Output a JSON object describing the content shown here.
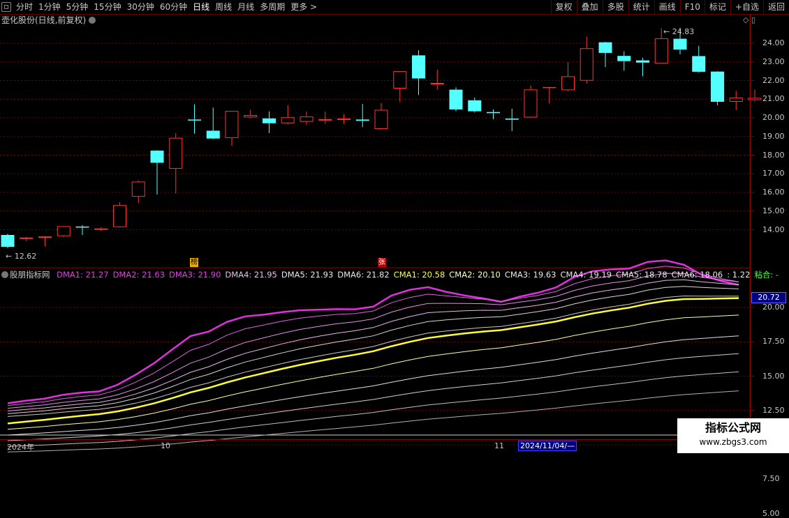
{
  "toolbar": {
    "tabs": [
      "分时",
      "1分钟",
      "5分钟",
      "15分钟",
      "30分钟",
      "60分钟",
      "日线",
      "周线",
      "月线",
      "多周期",
      "更多 >"
    ],
    "active_tab": "日线",
    "right_buttons": [
      "复权",
      "叠加",
      "多股",
      "统计",
      "画线",
      "F10",
      "标记",
      "+自选",
      "返回"
    ]
  },
  "stock_title": "壶化股份(日线,前复权)",
  "price_axis": [
    "24.00",
    "23.00",
    "22.00",
    "21.00",
    "20.00",
    "19.00",
    "18.00",
    "17.00",
    "16.00",
    "15.00",
    "14.00"
  ],
  "indicator_axis": [
    "20.00",
    "17.50",
    "15.00",
    "12.50",
    "10.00",
    "7.50",
    "5.00"
  ],
  "current_value": "20.72",
  "annotations": {
    "high": "24.83",
    "low": "12.62",
    "tag1": "榜",
    "tag2": "张"
  },
  "indicator": {
    "name": "股朋指标网",
    "items": [
      {
        "label": "DMA1: 21.27",
        "color": "#e040e0"
      },
      {
        "label": "DMA2: 21.63",
        "color": "#e040e0"
      },
      {
        "label": "DMA3: 21.90",
        "color": "#e040e0"
      },
      {
        "label": "DMA4: 21.95",
        "color": "#e8c0e8"
      },
      {
        "label": "DMA5: 21.93",
        "color": "#e8e8e8"
      },
      {
        "label": "DMA6: 21.82",
        "color": "#e8e8e8"
      },
      {
        "label": "CMA1: 20.58",
        "color": "#ffff40"
      },
      {
        "label": "CMA2: 20.10",
        "color": "#ffffc0"
      },
      {
        "label": "CMA3: 19.63",
        "color": "#e8e8e8"
      },
      {
        "label": "CMA4: 19.19",
        "color": "#e8e8e8"
      },
      {
        "label": "CMA5: 18.78",
        "color": "#e8e8e8"
      },
      {
        "label": "CMA6: 18.06",
        "color": "#e8e8e8"
      },
      {
        "label": ": 1.22",
        "color": "#e8e8e8"
      },
      {
        "label": "粘合: -",
        "color": "#40ff40"
      }
    ]
  },
  "date_axis": {
    "start": "2024年",
    "m1": "10",
    "m2": "11",
    "cursor": "2024/11/04/—"
  },
  "watermark": {
    "line1": "指标公式网",
    "line2": "www.zbgs3.com"
  },
  "chart_data": {
    "type": "candlestick",
    "candles": [
      {
        "o": 13.72,
        "h": 13.78,
        "l": 13.02,
        "c": 13.08
      },
      {
        "o": 13.52,
        "h": 13.62,
        "l": 13.38,
        "c": 13.58
      },
      {
        "o": 13.57,
        "h": 13.66,
        "l": 13.11,
        "c": 13.64
      },
      {
        "o": 13.66,
        "h": 14.2,
        "l": 13.6,
        "c": 14.19
      },
      {
        "o": 14.17,
        "h": 14.25,
        "l": 13.72,
        "c": 14.13
      },
      {
        "o": 13.99,
        "h": 14.14,
        "l": 13.94,
        "c": 14.07
      },
      {
        "o": 14.14,
        "h": 15.48,
        "l": 14.11,
        "c": 15.32
      },
      {
        "o": 15.77,
        "h": 16.64,
        "l": 15.43,
        "c": 16.58
      },
      {
        "o": 18.24,
        "h": 18.27,
        "l": 15.89,
        "c": 17.59
      },
      {
        "o": 17.27,
        "h": 19.18,
        "l": 15.94,
        "c": 18.93
      },
      {
        "o": 19.91,
        "h": 20.72,
        "l": 19.15,
        "c": 19.89
      },
      {
        "o": 19.31,
        "h": 20.55,
        "l": 18.86,
        "c": 18.89
      },
      {
        "o": 18.92,
        "h": 20.38,
        "l": 18.49,
        "c": 20.37
      },
      {
        "o": 20.03,
        "h": 20.43,
        "l": 19.99,
        "c": 20.15
      },
      {
        "o": 19.97,
        "h": 20.35,
        "l": 19.18,
        "c": 19.71
      },
      {
        "o": 19.71,
        "h": 20.68,
        "l": 19.65,
        "c": 20.03
      },
      {
        "o": 19.79,
        "h": 20.33,
        "l": 19.63,
        "c": 20.07
      },
      {
        "o": 19.91,
        "h": 20.33,
        "l": 19.68,
        "c": 19.93
      },
      {
        "o": 19.93,
        "h": 20.18,
        "l": 19.68,
        "c": 19.96
      },
      {
        "o": 19.91,
        "h": 20.74,
        "l": 19.5,
        "c": 19.84
      },
      {
        "o": 19.4,
        "h": 20.79,
        "l": 19.37,
        "c": 20.43
      },
      {
        "o": 21.57,
        "h": 22.5,
        "l": 20.85,
        "c": 22.5
      },
      {
        "o": 23.35,
        "h": 23.62,
        "l": 21.22,
        "c": 22.11
      },
      {
        "o": 21.83,
        "h": 22.59,
        "l": 21.51,
        "c": 21.87
      },
      {
        "o": 21.51,
        "h": 21.63,
        "l": 20.35,
        "c": 20.45
      },
      {
        "o": 20.94,
        "h": 21.09,
        "l": 20.28,
        "c": 20.35
      },
      {
        "o": 20.31,
        "h": 20.46,
        "l": 19.93,
        "c": 20.25
      },
      {
        "o": 19.96,
        "h": 20.49,
        "l": 19.29,
        "c": 19.9
      },
      {
        "o": 20.02,
        "h": 21.73,
        "l": 19.99,
        "c": 21.52
      },
      {
        "o": 21.65,
        "h": 21.65,
        "l": 20.76,
        "c": 21.65
      },
      {
        "o": 21.48,
        "h": 22.98,
        "l": 21.42,
        "c": 22.23
      },
      {
        "o": 21.99,
        "h": 24.36,
        "l": 21.84,
        "c": 23.73
      },
      {
        "o": 24.05,
        "h": 24.08,
        "l": 22.72,
        "c": 23.48
      },
      {
        "o": 23.32,
        "h": 23.57,
        "l": 22.53,
        "c": 23.04
      },
      {
        "o": 23.08,
        "h": 23.21,
        "l": 22.23,
        "c": 22.96
      },
      {
        "o": 22.91,
        "h": 24.8,
        "l": 22.9,
        "c": 24.26
      },
      {
        "o": 24.24,
        "h": 24.83,
        "l": 23.4,
        "c": 23.66
      },
      {
        "o": 23.31,
        "h": 23.86,
        "l": 22.42,
        "c": 22.47
      },
      {
        "o": 22.48,
        "h": 22.5,
        "l": 20.67,
        "c": 20.86
      },
      {
        "o": 20.86,
        "h": 21.44,
        "l": 20.42,
        "c": 21.09
      },
      {
        "o": 20.95,
        "h": 21.51,
        "l": 20.89,
        "c": 21.07
      }
    ]
  }
}
